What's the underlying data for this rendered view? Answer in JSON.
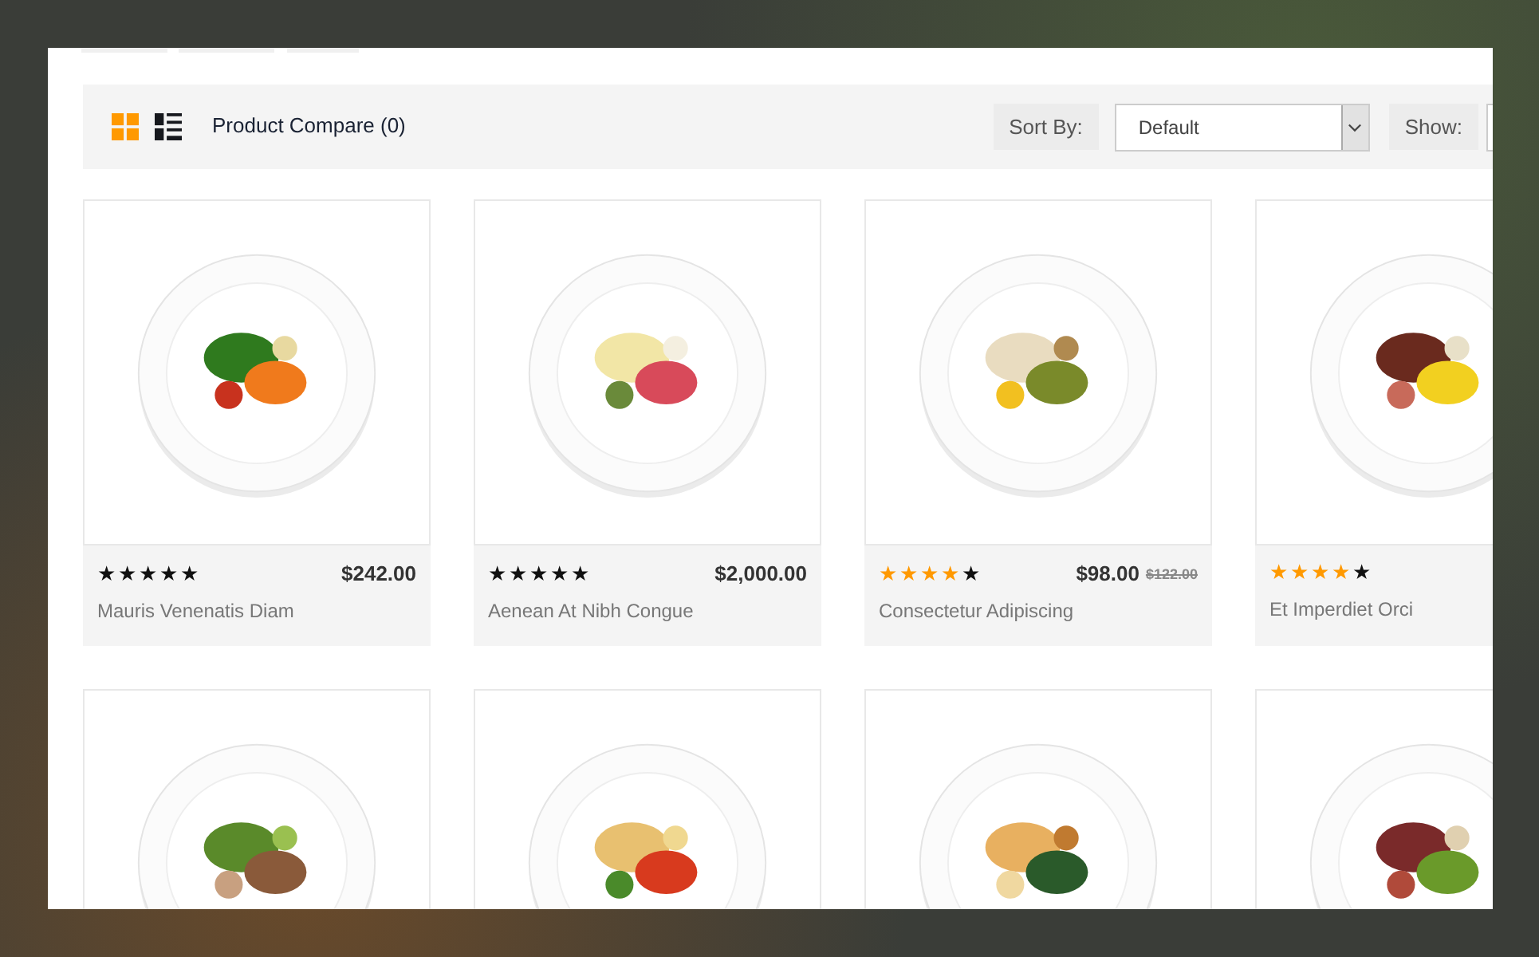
{
  "toolbar": {
    "views": [
      {
        "kind": "grid",
        "selected": true
      },
      {
        "kind": "list",
        "selected": false
      }
    ],
    "compare": "Product Compare (0)",
    "sort_label": "Sort By:",
    "sort_value": "Default",
    "show_label": "Show:"
  },
  "products": [
    {
      "name": "Mauris Venenatis Diam",
      "price": "$242.00",
      "stars": 5,
      "color": "#111111"
    },
    {
      "name": "Aenean At Nibh Congue",
      "price": "$2,000.00",
      "stars": 5,
      "color": "#111111"
    },
    {
      "name": "Consectetur Adipiscing",
      "price": "$98.00",
      "old_price": "$122.00",
      "stars": 4,
      "color": "#ff9900"
    },
    {
      "name": "Et Imperdiet Orci",
      "stars": 4,
      "color": "#ff9900"
    }
  ],
  "more_products": [
    {
      "kind": "photo"
    },
    {
      "kind": "photo"
    },
    {
      "kind": "photo"
    },
    {
      "kind": "photo"
    }
  ]
}
